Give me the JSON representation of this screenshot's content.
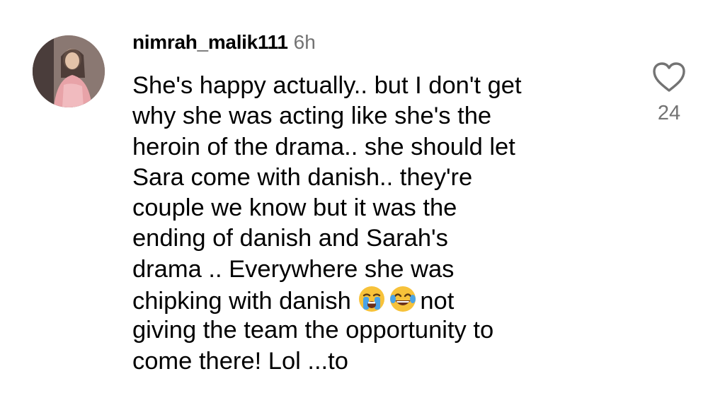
{
  "comment": {
    "username": "nimrah_malik111",
    "timestamp": "6h",
    "lines": [
      "She's happy actually.. but I don't get",
      "why she was acting like she's the",
      "heroin of the drama.. she should let",
      "Sara come with danish.. they're",
      "couple we know but it was the",
      "ending of danish and Sarah's",
      "drama .. Everywhere she was",
      "chipking with danish",
      "not",
      "giving the team the opportunity to",
      "come there! Lol ...to"
    ],
    "emojis": [
      "loudly-crying-face-emoji",
      "face-with-tears-of-joy-emoji"
    ],
    "like_icon": "heart-outline-icon",
    "like_count": "24",
    "colors": {
      "text": "#000000",
      "secondary": "#737373",
      "background": "#ffffff"
    }
  }
}
